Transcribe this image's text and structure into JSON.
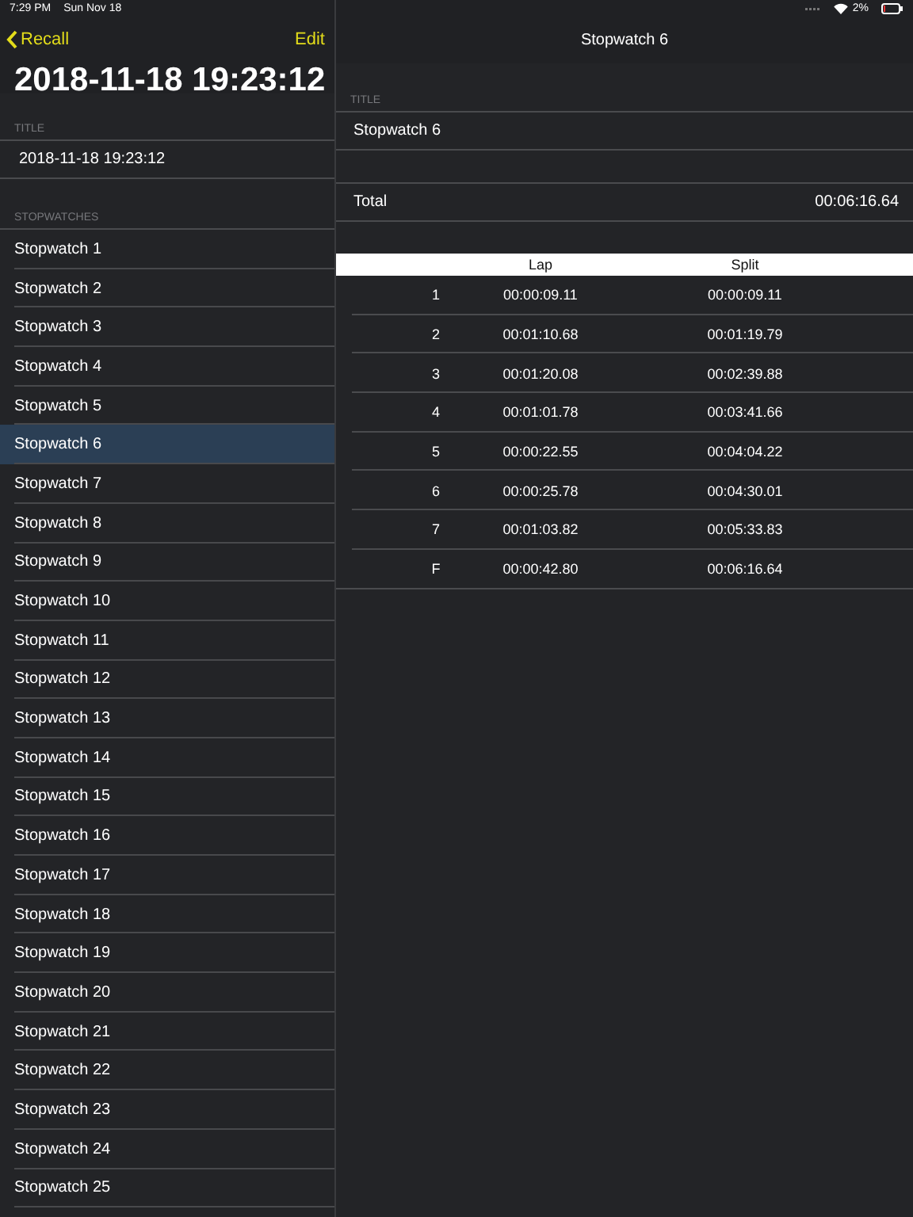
{
  "status_bar": {
    "time": "7:29 PM",
    "date": "Sun Nov 18",
    "battery": "2%"
  },
  "master": {
    "back_label": "Recall",
    "edit_label": "Edit",
    "large_title": "2018-11-18 19:23:12",
    "title_section": "TITLE",
    "title_value": "2018-11-18 19:23:12",
    "list_section": "STOPWATCHES",
    "items": [
      {
        "label": "Stopwatch 1",
        "selected": false
      },
      {
        "label": "Stopwatch 2",
        "selected": false
      },
      {
        "label": "Stopwatch 3",
        "selected": false
      },
      {
        "label": "Stopwatch 4",
        "selected": false
      },
      {
        "label": "Stopwatch 5",
        "selected": false
      },
      {
        "label": "Stopwatch 6",
        "selected": true
      },
      {
        "label": "Stopwatch 7",
        "selected": false
      },
      {
        "label": "Stopwatch 8",
        "selected": false
      },
      {
        "label": "Stopwatch 9",
        "selected": false
      },
      {
        "label": "Stopwatch 10",
        "selected": false
      },
      {
        "label": "Stopwatch 11",
        "selected": false
      },
      {
        "label": "Stopwatch 12",
        "selected": false
      },
      {
        "label": "Stopwatch 13",
        "selected": false
      },
      {
        "label": "Stopwatch 14",
        "selected": false
      },
      {
        "label": "Stopwatch 15",
        "selected": false
      },
      {
        "label": "Stopwatch 16",
        "selected": false
      },
      {
        "label": "Stopwatch 17",
        "selected": false
      },
      {
        "label": "Stopwatch 18",
        "selected": false
      },
      {
        "label": "Stopwatch 19",
        "selected": false
      },
      {
        "label": "Stopwatch 20",
        "selected": false
      },
      {
        "label": "Stopwatch 21",
        "selected": false
      },
      {
        "label": "Stopwatch 22",
        "selected": false
      },
      {
        "label": "Stopwatch 23",
        "selected": false
      },
      {
        "label": "Stopwatch 24",
        "selected": false
      },
      {
        "label": "Stopwatch 25",
        "selected": false
      }
    ]
  },
  "detail": {
    "nav_title": "Stopwatch 6",
    "title_section": "TITLE",
    "title_value": "Stopwatch 6",
    "total_label": "Total",
    "total_value": "00:06:16.64",
    "table": {
      "columns": [
        "",
        "Lap",
        "Split"
      ],
      "rows": [
        [
          "1",
          "00:00:09.11",
          "00:00:09.11"
        ],
        [
          "2",
          "00:01:10.68",
          "00:01:19.79"
        ],
        [
          "3",
          "00:01:20.08",
          "00:02:39.88"
        ],
        [
          "4",
          "00:01:01.78",
          "00:03:41.66"
        ],
        [
          "5",
          "00:00:22.55",
          "00:04:04.22"
        ],
        [
          "6",
          "00:00:25.78",
          "00:04:30.01"
        ],
        [
          "7",
          "00:01:03.82",
          "00:05:33.83"
        ],
        [
          "F",
          "00:00:42.80",
          "00:06:16.64"
        ]
      ]
    }
  }
}
